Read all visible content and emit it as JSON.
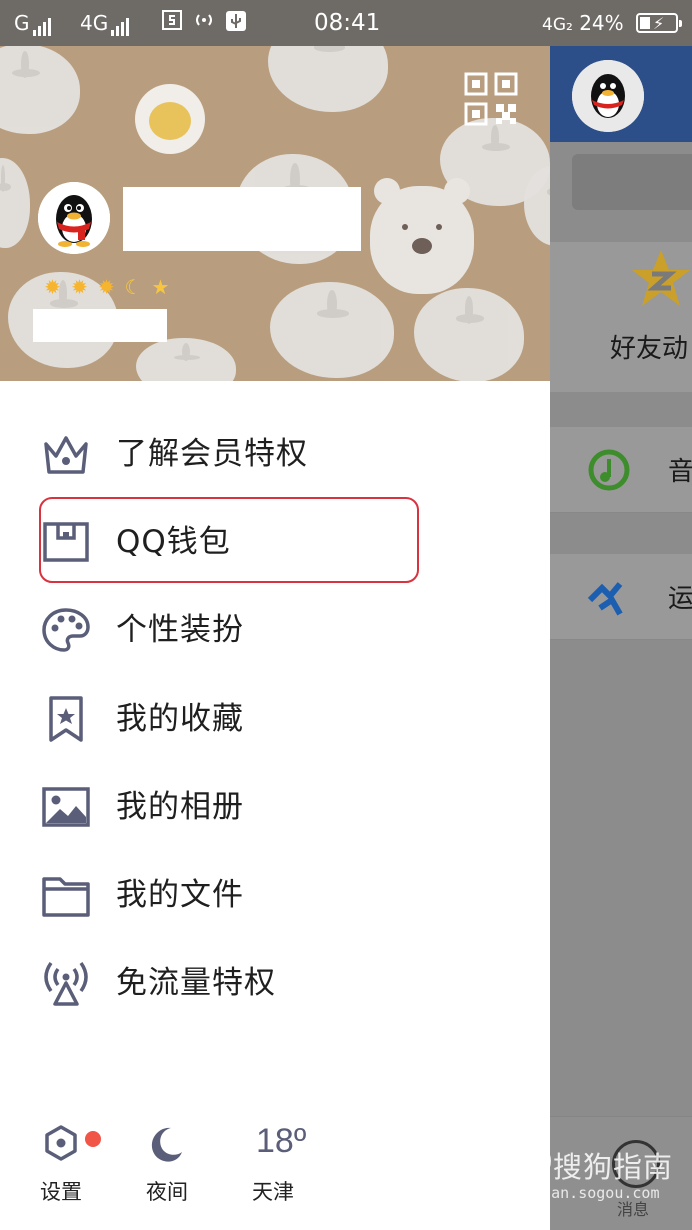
{
  "status_bar": {
    "sim1": "G",
    "sim2": "4G",
    "time": "08:41",
    "network_right": "4G₂",
    "battery": "24%"
  },
  "profile": {
    "level_icons": [
      "sun",
      "sun",
      "sun",
      "moon",
      "star"
    ]
  },
  "menu": {
    "items": [
      {
        "label": "了解会员特权",
        "icon": "crown-icon"
      },
      {
        "label": "QQ钱包",
        "icon": "wallet-icon"
      },
      {
        "label": "个性装扮",
        "icon": "palette-icon"
      },
      {
        "label": "我的收藏",
        "icon": "bookmark-star-icon"
      },
      {
        "label": "我的相册",
        "icon": "image-icon"
      },
      {
        "label": "我的文件",
        "icon": "folder-icon"
      },
      {
        "label": "免流量特权",
        "icon": "signal-tower-icon"
      }
    ]
  },
  "footer": {
    "settings_label": "设置",
    "night_label": "夜间",
    "temperature": "18º",
    "city": "天津"
  },
  "background_app": {
    "friends_label": "好友动",
    "row1_label": "音",
    "row2_label": "运",
    "message_label": "消息"
  },
  "watermark": {
    "main": "搜狗指南",
    "sub": "zhinan.sogou.com"
  },
  "colors": {
    "highlight": "#d9333f",
    "icon": "#5a5e78",
    "badge": "#f05548",
    "profile_bg": "#b89e7e"
  }
}
